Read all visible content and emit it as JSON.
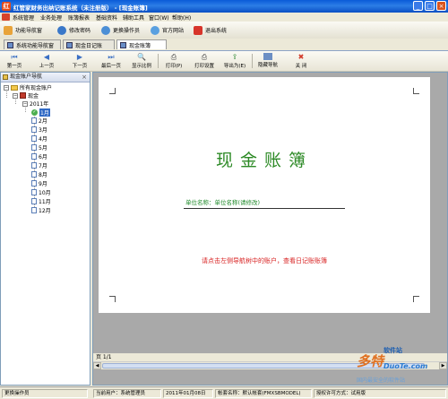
{
  "window": {
    "title": "红管家财务出纳记账系统（未注册版） - [现金账簿]"
  },
  "menu": {
    "items": [
      "系统管理",
      "业务处理",
      "账簿报表",
      "基础资料",
      "辅助工具",
      "窗口(W)",
      "帮助(H)"
    ]
  },
  "toolbar": {
    "buttons": [
      "功能导航窗",
      "修改密码",
      "更换操作员",
      "官方网站",
      "退出系统"
    ]
  },
  "tabs": [
    "系统功能导航窗",
    "现金日记账",
    "现金账簿"
  ],
  "report_toolbar": {
    "buttons": [
      "第一页",
      "上一页",
      "下一页",
      "最后一页",
      "显示比例",
      "打印(P)",
      "打印设置",
      "导出为(E)",
      "隐藏导航",
      "关 闭"
    ]
  },
  "left_panel": {
    "header": "现金账户导航",
    "tree": {
      "root": "所有现金账户",
      "account": "现金",
      "year": "2011年",
      "months": [
        "1月",
        "2月",
        "3月",
        "4月",
        "5月",
        "6月",
        "7月",
        "8月",
        "9月",
        "10月",
        "11月",
        "12月"
      ],
      "selected_month": "1月"
    }
  },
  "report": {
    "title": "现金账簿",
    "unit_label": "单位名称：单位名称(请修改)",
    "hint": "请点击左侧导航树中的账户，查看日记账账簿",
    "page": "页 1/1"
  },
  "status": {
    "fields": [
      "更换操作员",
      "当前用户：系统管理员",
      "2011年01月08日",
      "帐套名称：默认帐套(FMXSBMODEL)",
      "授权许可方式：试用版"
    ]
  },
  "watermark": {
    "logo": "多特",
    "sub": "软件站",
    "url": "DuoTe.com",
    "slogan": "国内最安全的软件站"
  }
}
